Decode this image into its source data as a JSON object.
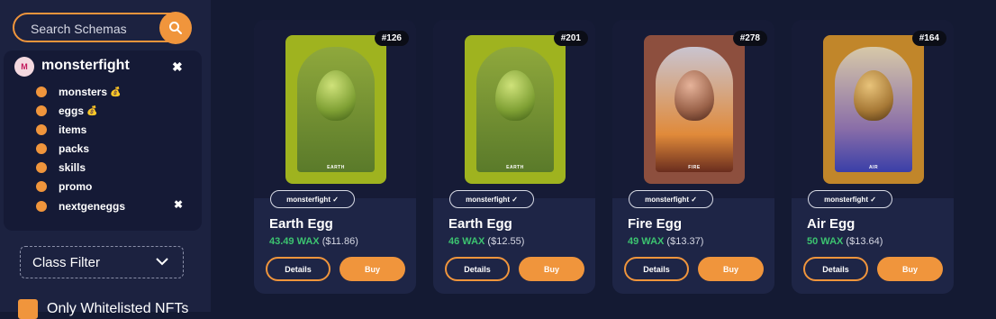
{
  "sidebar": {
    "search": {
      "placeholder": "Search Schemas",
      "icon": "search-icon"
    },
    "collection": {
      "avatar_text": "M",
      "name": "monsterfight",
      "remove_icon": "✖",
      "schemas": [
        {
          "label": "monsters",
          "coin": true
        },
        {
          "label": "eggs",
          "coin": true
        },
        {
          "label": "items",
          "coin": false
        },
        {
          "label": "packs",
          "coin": false
        },
        {
          "label": "skills",
          "coin": false
        },
        {
          "label": "promo",
          "coin": false
        },
        {
          "label": "nextgeneggs",
          "coin": false,
          "removable": true
        }
      ],
      "coin_glyph": "💰",
      "schema_remove_icon": "✖"
    },
    "class_filter": {
      "label": "Class Filter"
    },
    "whitelist": {
      "label": "Only Whitelisted NFTs",
      "checked": true
    }
  },
  "cards": [
    {
      "badge": "#126",
      "collection": "monsterfight ✓",
      "title": "Earth Egg",
      "price_wax": "43.49 WAX",
      "price_usd": "($11.86)",
      "art_label": "EARTH",
      "frame_color": "#9fb31f",
      "bg_color": "#6f8a2a",
      "egg_color": "#7fa034",
      "details": "Details",
      "buy": "Buy"
    },
    {
      "badge": "#201",
      "collection": "monsterfight ✓",
      "title": "Earth Egg",
      "price_wax": "46 WAX",
      "price_usd": "($12.55)",
      "art_label": "EARTH",
      "frame_color": "#9fb31f",
      "bg_color": "#6f8a2a",
      "egg_color": "#7fa034",
      "details": "Details",
      "buy": "Buy"
    },
    {
      "badge": "#278",
      "collection": "monsterfight ✓",
      "title": "Fire Egg",
      "price_wax": "49 WAX",
      "price_usd": "($13.37)",
      "art_label": "FIRE",
      "frame_color": "#8d4f3e",
      "bg_color": "#b6a4a8",
      "egg_color": "#9a6249",
      "details": "Details",
      "buy": "Buy"
    },
    {
      "badge": "#164",
      "collection": "monsterfight ✓",
      "title": "Air Egg",
      "price_wax": "50 WAX",
      "price_usd": "($13.64)",
      "art_label": "AIR",
      "frame_color": "#c1862a",
      "bg_color": "#8a6ea8",
      "egg_color": "#a77936",
      "details": "Details",
      "buy": "Buy"
    }
  ]
}
